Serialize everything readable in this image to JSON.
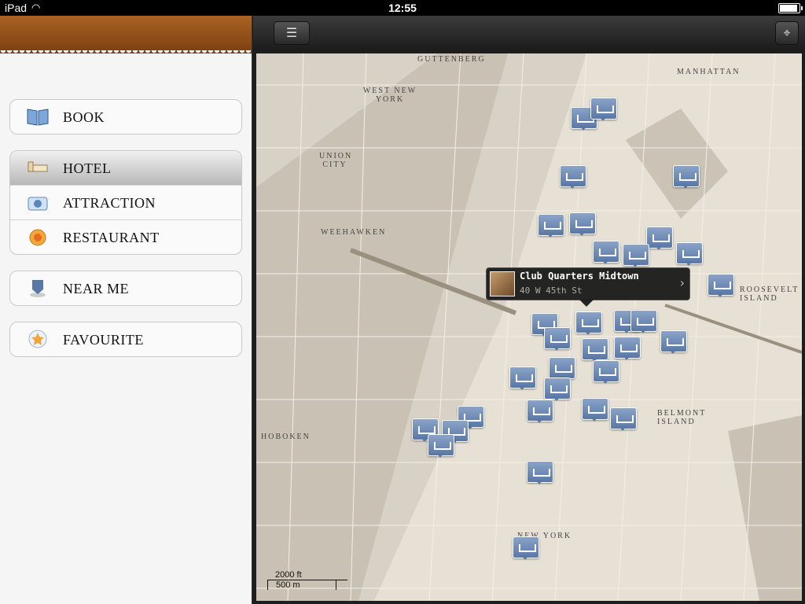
{
  "status_bar": {
    "carrier": "iPad",
    "time": "12:55"
  },
  "sidebar": {
    "groups": [
      {
        "items": [
          {
            "label": "BOOK",
            "icon": "book-icon",
            "selected": false
          }
        ]
      },
      {
        "items": [
          {
            "label": "HOTEL",
            "icon": "bed-icon",
            "selected": true
          },
          {
            "label": "ATTRACTION",
            "icon": "camera-icon",
            "selected": false
          },
          {
            "label": "RESTAURANT",
            "icon": "plate-icon",
            "selected": false
          }
        ]
      },
      {
        "items": [
          {
            "label": "NEAR ME",
            "icon": "location-pin-icon",
            "selected": false
          }
        ]
      },
      {
        "items": [
          {
            "label": "FAVOURITE",
            "icon": "star-icon",
            "selected": false
          }
        ]
      }
    ]
  },
  "toolbar": {
    "list_icon": "list-icon",
    "locate_icon": "crosshair-icon"
  },
  "map": {
    "callout": {
      "title": "Club Quarters Midtown",
      "subtitle": "40 W 45th St"
    },
    "scale": {
      "imperial": "2000 ft",
      "metric": "500 m"
    },
    "labels": [
      "GUTTENBERG",
      "WEST NEW YORK",
      "MANHATTAN",
      "UNION CITY",
      "WEEHAWKEN",
      "ROOSEVELT ISLAND",
      "HOBOKEN",
      "BELMONT ISLAND",
      "NEW YORK"
    ],
    "pin_color": "#5a78a6",
    "map_tint": "#d8d2c6"
  }
}
